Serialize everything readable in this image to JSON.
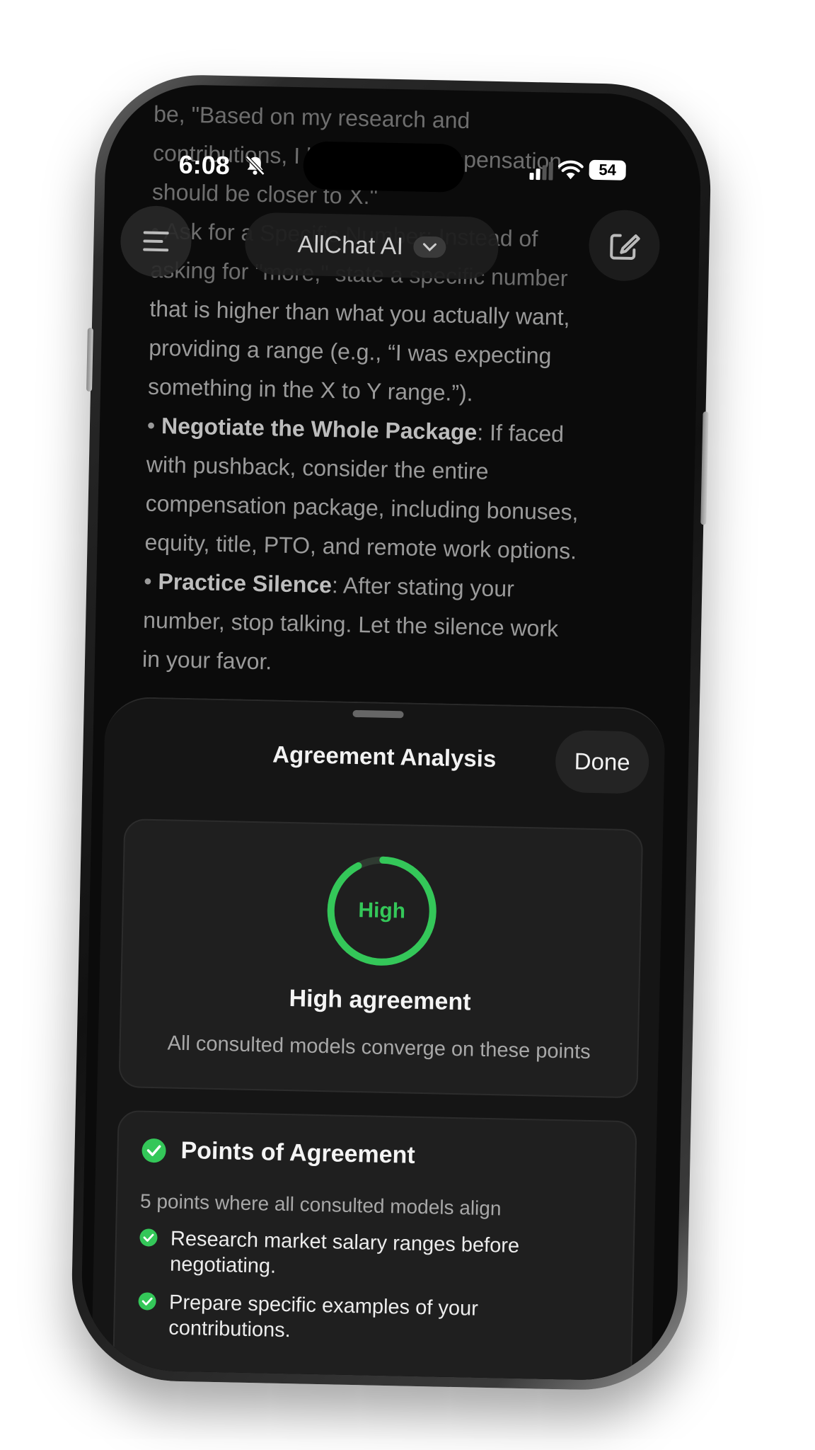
{
  "status_bar": {
    "time": "6:08",
    "battery": "54"
  },
  "chat": {
    "lines": [
      "be, \"Based on my research and",
      "contributions, I believe my compensation",
      "should be closer to X.\"",
      "• Ask for a Specific Number: Instead of",
      "asking for \"more,\" state a specific number",
      "that is higher than what you actually want,",
      "providing a range (e.g., “I was expecting",
      "something in the X to Y range.”)."
    ],
    "bullet_1_bold": "Negotiate the Whole Package",
    "bullet_1_rest": ": If faced",
    "bullet_1_lines": [
      "with pushback, consider the entire",
      "compensation package, including bonuses,",
      "equity, title, PTO, and remote work options."
    ],
    "bullet_2_bold": "Practice Silence",
    "bullet_2_rest": ": After stating your",
    "bullet_2_lines": [
      "number, stop talking. Let the silence work",
      "in your favor."
    ]
  },
  "nav": {
    "title": "AllChat AI"
  },
  "sheet": {
    "title": "Agreement Analysis",
    "done_label": "Done",
    "summary": {
      "gauge_label": "High",
      "gauge_level": 0.92,
      "title": "High agreement",
      "subtitle": "All consulted models converge on these points"
    },
    "points": {
      "title": "Points of Agreement",
      "subtitle": "5 points where all consulted models align",
      "items": [
        "Research market salary ranges before negotiating.",
        "Prepare specific examples of your contributions."
      ]
    }
  },
  "colors": {
    "accent_green": "#34c759",
    "sheet_bg": "#151515",
    "card_bg": "#1f1f1f"
  }
}
